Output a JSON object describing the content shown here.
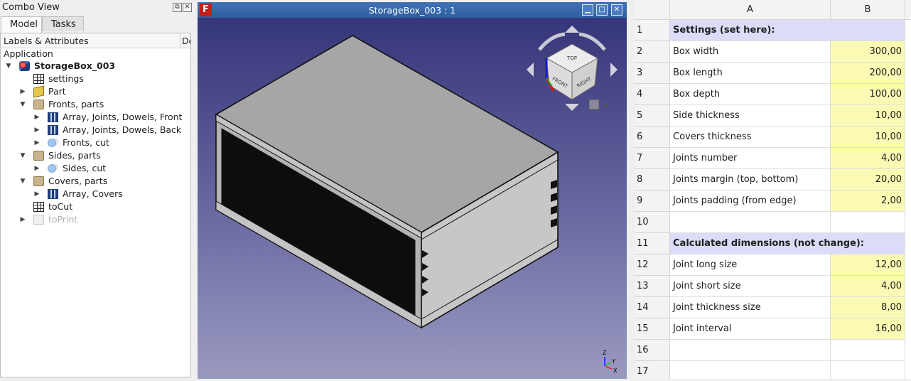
{
  "combo": {
    "title": "Combo View",
    "tabs": [
      {
        "label": "Model"
      },
      {
        "label": "Tasks"
      }
    ],
    "tree_header": {
      "labels": "Labels & Attributes",
      "desc": "De"
    },
    "application": "Application",
    "items": [
      {
        "label": "StorageBox_003",
        "icon": "freecad-document-icon"
      },
      {
        "label": "settings",
        "icon": "spreadsheet-icon"
      },
      {
        "label": "Part",
        "icon": "part-icon"
      },
      {
        "label": "Fronts, parts",
        "icon": "folder-icon"
      },
      {
        "label": "Array, Joints, Dowels, Front",
        "icon": "array-icon"
      },
      {
        "label": "Array, Joints, Dowels, Back",
        "icon": "array-icon"
      },
      {
        "label": "Fronts, cut",
        "icon": "cut-icon"
      },
      {
        "label": "Sides, parts",
        "icon": "folder-icon"
      },
      {
        "label": "Sides, cut",
        "icon": "cut-icon"
      },
      {
        "label": "Covers, parts",
        "icon": "folder-icon"
      },
      {
        "label": "Array, Covers",
        "icon": "array-icon"
      },
      {
        "label": "toCut",
        "icon": "spreadsheet-icon"
      },
      {
        "label": "toPrint",
        "icon": "hidden-document-icon"
      }
    ]
  },
  "view": {
    "title": "StorageBox_003 : 1",
    "navcube_faces": {
      "top": "TOP",
      "front": "FRONT",
      "right": "RIGHT"
    },
    "axes": {
      "x": "X",
      "y": "Y",
      "z": "Z"
    }
  },
  "sheet": {
    "columns": [
      "A",
      "B"
    ],
    "rows": [
      {
        "n": "1",
        "a": "Settings (set here):",
        "b": "",
        "style": "header"
      },
      {
        "n": "2",
        "a": "Box width",
        "b": "300,00",
        "style": "value"
      },
      {
        "n": "3",
        "a": "Box length",
        "b": "200,00",
        "style": "value"
      },
      {
        "n": "4",
        "a": "Box depth",
        "b": "100,00",
        "style": "value"
      },
      {
        "n": "5",
        "a": "Side thickness",
        "b": "10,00",
        "style": "value"
      },
      {
        "n": "6",
        "a": "Covers thickness",
        "b": "10,00",
        "style": "value"
      },
      {
        "n": "7",
        "a": "Joints number",
        "b": "4,00",
        "style": "value"
      },
      {
        "n": "8",
        "a": "Joints margin (top, bottom)",
        "b": "20,00",
        "style": "value"
      },
      {
        "n": "9",
        "a": "Joints padding (from edge)",
        "b": "2,00",
        "style": "value"
      },
      {
        "n": "10",
        "a": "",
        "b": "",
        "style": "empty"
      },
      {
        "n": "11",
        "a": "Calculated dimensions (not change):",
        "b": "",
        "style": "header"
      },
      {
        "n": "12",
        "a": "Joint long size",
        "b": "12,00",
        "style": "value"
      },
      {
        "n": "13",
        "a": "Joint short size",
        "b": "4,00",
        "style": "value"
      },
      {
        "n": "14",
        "a": "Joint thickness size",
        "b": "8,00",
        "style": "value"
      },
      {
        "n": "15",
        "a": "Joint interval",
        "b": "16,00",
        "style": "value"
      },
      {
        "n": "16",
        "a": "",
        "b": "",
        "style": "empty"
      },
      {
        "n": "17",
        "a": "",
        "b": "",
        "style": "empty"
      }
    ]
  },
  "colors": {
    "sheet_header_bg": "#dcdcf8",
    "sheet_value_bg": "#fafab4",
    "titlebar": "#3f72b6"
  }
}
